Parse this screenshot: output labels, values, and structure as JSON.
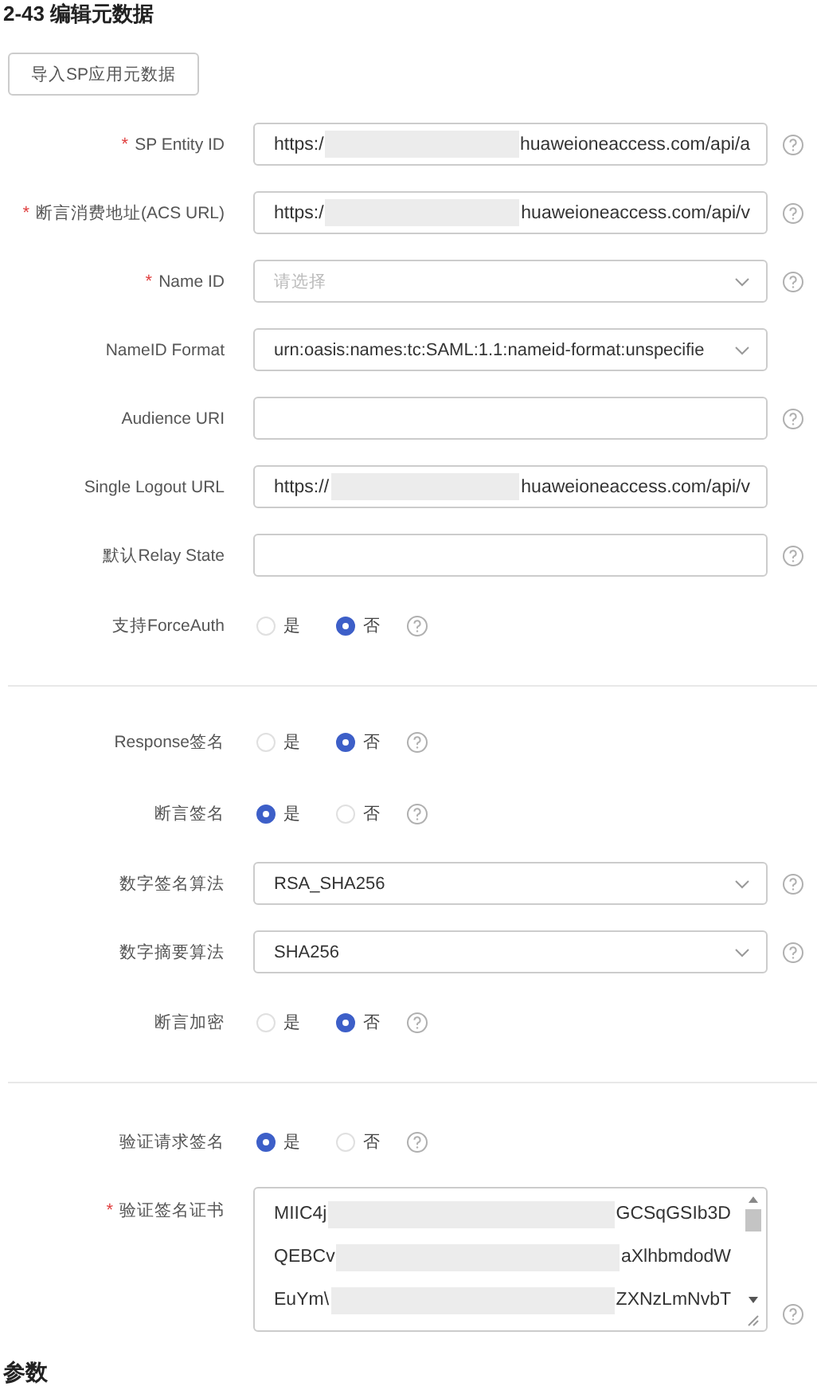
{
  "caption": "2-43 编辑元数据",
  "import_button": "导入SP应用元数据",
  "sections": [
    {
      "rows": [
        {
          "kind": "text",
          "required_mark": "*",
          "label": "SP Entity ID",
          "value_start": "https:/",
          "redacted": true,
          "value_end": "huaweioneaccess.com/api/a",
          "help": true
        },
        {
          "kind": "text",
          "required_mark": "*",
          "label": "断言消费地址(ACS URL)",
          "value_start": "https:/",
          "redacted": true,
          "value_end": "huaweioneaccess.com/api/v",
          "help": true
        },
        {
          "kind": "select",
          "required_mark": "*",
          "label": "Name ID",
          "placeholder": "请选择",
          "help": true
        },
        {
          "kind": "select",
          "label": "NameID Format",
          "value": "urn:oasis:names:tc:SAML:1.1:nameid-format:unspecifie",
          "help": false
        },
        {
          "kind": "text",
          "label": "Audience URI",
          "help": true
        },
        {
          "kind": "text",
          "label": "Single Logout URL",
          "value_start": "https://",
          "redacted": true,
          "value_end": "huaweioneaccess.com/api/v",
          "help": false
        },
        {
          "kind": "text",
          "label": "默认Relay State",
          "help": true
        },
        {
          "kind": "radio",
          "label": "支持ForceAuth",
          "options": [
            {
              "label": "是",
              "selected": false
            },
            {
              "label": "否",
              "selected": true
            }
          ],
          "help": true
        }
      ]
    },
    {
      "rows": [
        {
          "kind": "radio",
          "label": "Response签名",
          "options": [
            {
              "label": "是",
              "selected": false
            },
            {
              "label": "否",
              "selected": true
            }
          ],
          "help": true
        },
        {
          "kind": "radio",
          "label": "断言签名",
          "options": [
            {
              "label": "是",
              "selected": true
            },
            {
              "label": "否",
              "selected": false
            }
          ],
          "help": true
        },
        {
          "kind": "select",
          "label": "数字签名算法",
          "value": "RSA_SHA256",
          "help": true
        },
        {
          "kind": "select",
          "label": "数字摘要算法",
          "value": "SHA256",
          "help": true
        },
        {
          "kind": "radio",
          "label": "断言加密",
          "options": [
            {
              "label": "是",
              "selected": false
            },
            {
              "label": "否",
              "selected": true
            }
          ],
          "help": true
        }
      ]
    },
    {
      "rows": [
        {
          "kind": "radio",
          "label": "验证请求签名",
          "options": [
            {
              "label": "是",
              "selected": true
            },
            {
              "label": "否",
              "selected": false
            }
          ],
          "help": true
        },
        {
          "kind": "textarea",
          "required_mark": "*",
          "label": "验证签名证书",
          "lines": [
            {
              "start": "MIIC4j",
              "redacted": true,
              "end": "GCSqGSIb3D"
            },
            {
              "start": "QEBCv",
              "redacted": true,
              "end": "aXlhbmdodW"
            },
            {
              "start": "EuYm\\",
              "redacted": true,
              "end": "ZXNzLmNvbT"
            }
          ],
          "help": true
        }
      ]
    }
  ],
  "footer_heading": "参数"
}
